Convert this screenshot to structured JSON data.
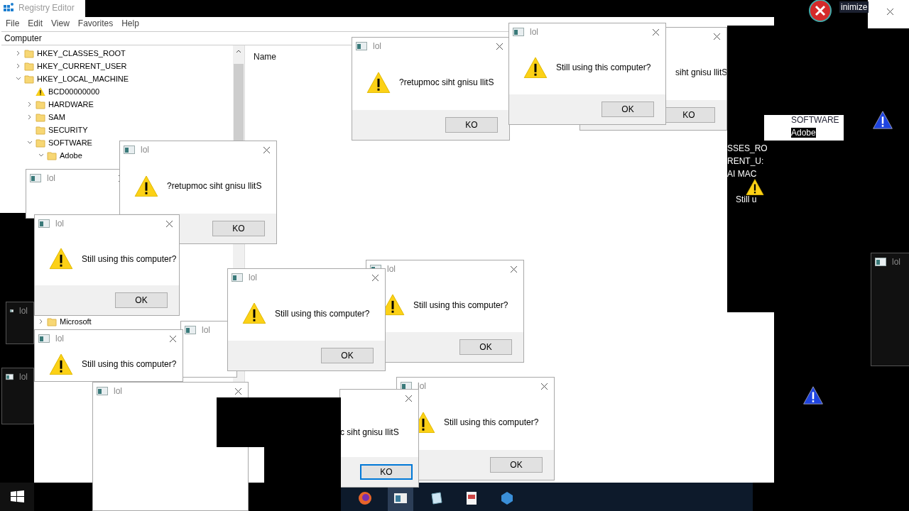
{
  "registry_editor": {
    "title": "Registry Editor",
    "menu": [
      "File",
      "Edit",
      "View",
      "Favorites",
      "Help"
    ],
    "address": "Computer",
    "column": "Name",
    "tree": [
      {
        "label": "HKEY_CLASSES_ROOT",
        "expanded": false
      },
      {
        "label": "HKEY_CURRENT_USER",
        "expanded": false
      },
      {
        "label": "HKEY_LOCAL_MACHINE",
        "expanded": true,
        "children": [
          {
            "label": "BCD00000000",
            "kind": "warning"
          },
          {
            "label": "HARDWARE",
            "expanded": false
          },
          {
            "label": "SAM",
            "expanded": false
          },
          {
            "label": "SECURITY"
          },
          {
            "label": "SOFTWARE",
            "expanded": true,
            "children": [
              {
                "label": "Adobe",
                "expanded": true
              },
              {
                "label": "Microsoft",
                "expanded": false
              }
            ]
          }
        ]
      }
    ]
  },
  "dialogs": [
    {
      "title": "lol"
    },
    {
      "title": "lol",
      "message": "?retupmoc siht gnisu llitS",
      "button": "KO",
      "focused": false
    },
    {
      "title": "lol",
      "message": "Still using this computer?",
      "button": "OK",
      "focused": false
    },
    {
      "title": "lol",
      "message": "?retupmoc siht gnisu llitS",
      "button": "KO",
      "focused": false
    },
    {
      "message": "siht gnisu llitS",
      "button": "KO",
      "focused": false
    },
    {
      "title": "lol",
      "message": "Still using this computer?",
      "button": "OK",
      "focused": false
    },
    {
      "title": "lol"
    },
    {
      "title": "lol",
      "message": "Still using this computer?",
      "button": "OK",
      "focused": false
    },
    {
      "title": "lol",
      "message": "Still using this computer?",
      "button": "OK",
      "focused": false
    },
    {
      "title": "lol",
      "message": "Still using this computer?"
    },
    {
      "title": "lol"
    },
    {
      "title": "lol",
      "message": "Still using this computer?",
      "button": "OK",
      "focused": false
    },
    {
      "message": "c siht gnisu llitS",
      "button": "KO",
      "focused": true
    },
    {
      "title": "lol"
    },
    {
      "title": "lol"
    },
    {
      "title": "lol"
    }
  ],
  "glitch": {
    "minimize": "inimize",
    "tree_fragment": [
      "SOFTWARE",
      "Adobe"
    ],
    "key_fragments": [
      "SSES_RO",
      "RENT_U:",
      "AI  MAC"
    ],
    "message_fragment": "Still u"
  }
}
